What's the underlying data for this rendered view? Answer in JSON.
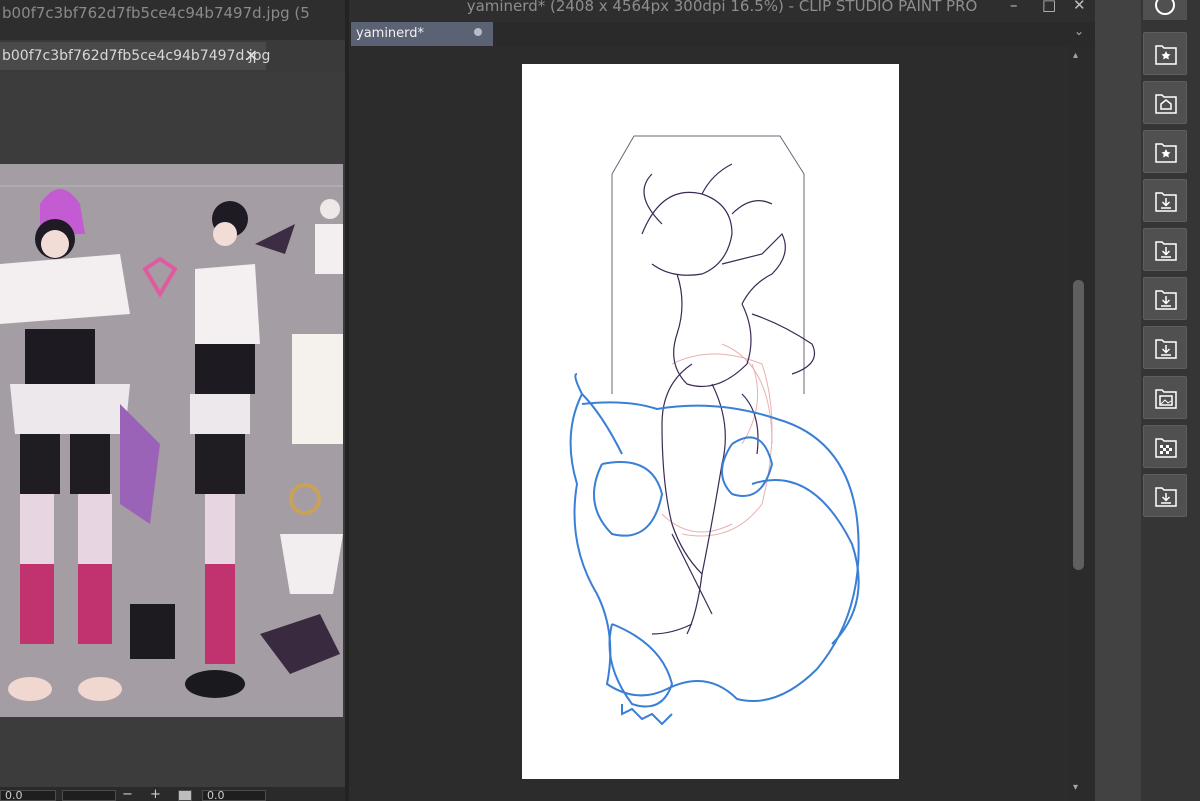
{
  "reference_window": {
    "title": "b00f7c3bf762d7fb5ce4c94b7497d.jpg (5",
    "tab_label": "b00f7c3bf762d7fb5ce4c94b7497d.jpg",
    "zoom_left": "0.0",
    "rotate_value": "0.0"
  },
  "app": {
    "title": "yaminerd* (2408 x 4564px 300dpi 16.5%)  - CLIP STUDIO PAINT PRO"
  },
  "canvas": {
    "tab_label": "yaminerd*"
  },
  "right_panel": {
    "buttons": [
      "navigator-icon",
      "star-material-icon",
      "home-material-icon",
      "star-material-icon",
      "download-material-icon",
      "download-material-icon",
      "download-material-icon",
      "download-material-icon",
      "image-material-icon",
      "pattern-material-icon",
      "download-material-icon"
    ]
  },
  "colors": {
    "background": "#2b2b2b",
    "tab_active": "#5b6273",
    "sketch_blue": "#3a7fd6",
    "sketch_purple": "#3b2a55",
    "sketch_pink": "#e8b4b4"
  }
}
